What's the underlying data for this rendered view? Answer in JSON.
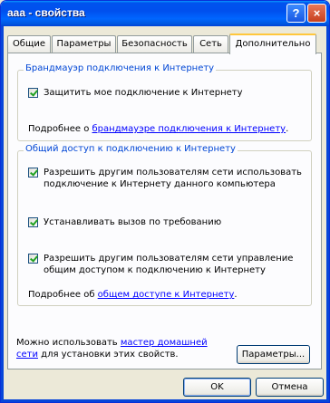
{
  "window": {
    "title": "aaa - свойства",
    "help_button": "?",
    "close_button": "×"
  },
  "tabs": [
    {
      "label": "Общие"
    },
    {
      "label": "Параметры"
    },
    {
      "label": "Безопасность"
    },
    {
      "label": "Сеть"
    },
    {
      "label": "Дополнительно",
      "active": true
    }
  ],
  "firewall": {
    "group_title": "Брандмауэр подключения к Интернету",
    "protect_label": "Защитить мое подключение к Интернету",
    "protect_checked": true,
    "more_prefix": "Подробнее о ",
    "more_link": "брандмауэре подключения к Интернету",
    "more_suffix": "."
  },
  "sharing": {
    "group_title": "Общий доступ к подключению к Интернету",
    "allow_users_label": "Разрешить другим пользователям сети использовать подключение к Интернету данного компьютера",
    "allow_users_checked": true,
    "dial_on_demand_label": "Устанавливать вызов по требованию",
    "dial_on_demand_checked": true,
    "allow_control_label": "Разрешить другим пользователям сети управление общим доступом к подключению к Интернету",
    "allow_control_checked": true,
    "more_prefix": "Подробнее об ",
    "more_link": "общем доступе к Интернету",
    "more_suffix": "."
  },
  "footer": {
    "text_prefix": "Можно использовать ",
    "wizard_link": "мастер домашней сети",
    "text_suffix": " для установки этих свойств.",
    "settings_button": "Параметры..."
  },
  "dialog_buttons": {
    "ok": "OK",
    "cancel": "Отмена"
  }
}
